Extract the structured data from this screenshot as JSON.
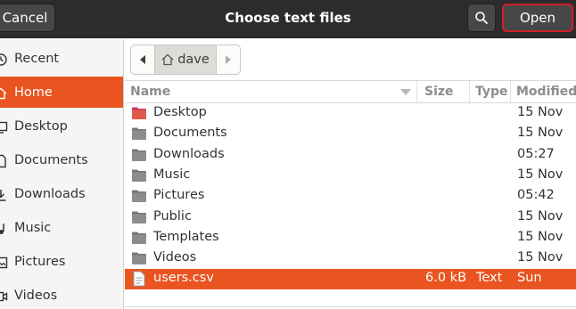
{
  "header": {
    "title": "Choose text files",
    "cancel_label": "Cancel",
    "open_label": "Open"
  },
  "sidebar": {
    "items": [
      {
        "label": "Recent",
        "icon": "clock-icon",
        "active": false
      },
      {
        "label": "Home",
        "icon": "home-icon",
        "active": true
      },
      {
        "label": "Desktop",
        "icon": "desktop-icon",
        "active": false
      },
      {
        "label": "Documents",
        "icon": "documents-icon",
        "active": false
      },
      {
        "label": "Downloads",
        "icon": "downloads-icon",
        "active": false
      },
      {
        "label": "Music",
        "icon": "music-icon",
        "active": false
      },
      {
        "label": "Pictures",
        "icon": "pictures-icon",
        "active": false
      },
      {
        "label": "Videos",
        "icon": "videos-icon",
        "active": false
      }
    ]
  },
  "pathbar": {
    "crumb": "dave"
  },
  "list": {
    "columns": {
      "name": "Name",
      "size": "Size",
      "type": "Type",
      "modified": "Modified"
    },
    "rows": [
      {
        "name": "Desktop",
        "size": "",
        "type": "",
        "modified": "15 Nov",
        "kind": "desktop-folder"
      },
      {
        "name": "Documents",
        "size": "",
        "type": "",
        "modified": "15 Nov",
        "kind": "folder"
      },
      {
        "name": "Downloads",
        "size": "",
        "type": "",
        "modified": "05:27",
        "kind": "folder"
      },
      {
        "name": "Music",
        "size": "",
        "type": "",
        "modified": "15 Nov",
        "kind": "folder"
      },
      {
        "name": "Pictures",
        "size": "",
        "type": "",
        "modified": "05:42",
        "kind": "folder"
      },
      {
        "name": "Public",
        "size": "",
        "type": "",
        "modified": "15 Nov",
        "kind": "folder"
      },
      {
        "name": "Templates",
        "size": "",
        "type": "",
        "modified": "15 Nov",
        "kind": "folder"
      },
      {
        "name": "Videos",
        "size": "",
        "type": "",
        "modified": "15 Nov",
        "kind": "folder"
      },
      {
        "name": "users.csv",
        "size": "6.0 kB",
        "type": "Text",
        "modified": "Sun",
        "kind": "file",
        "selected": true
      }
    ]
  },
  "colors": {
    "accent": "#e95420",
    "header_bg": "#2c2c2c",
    "open_border": "#d0202a"
  }
}
